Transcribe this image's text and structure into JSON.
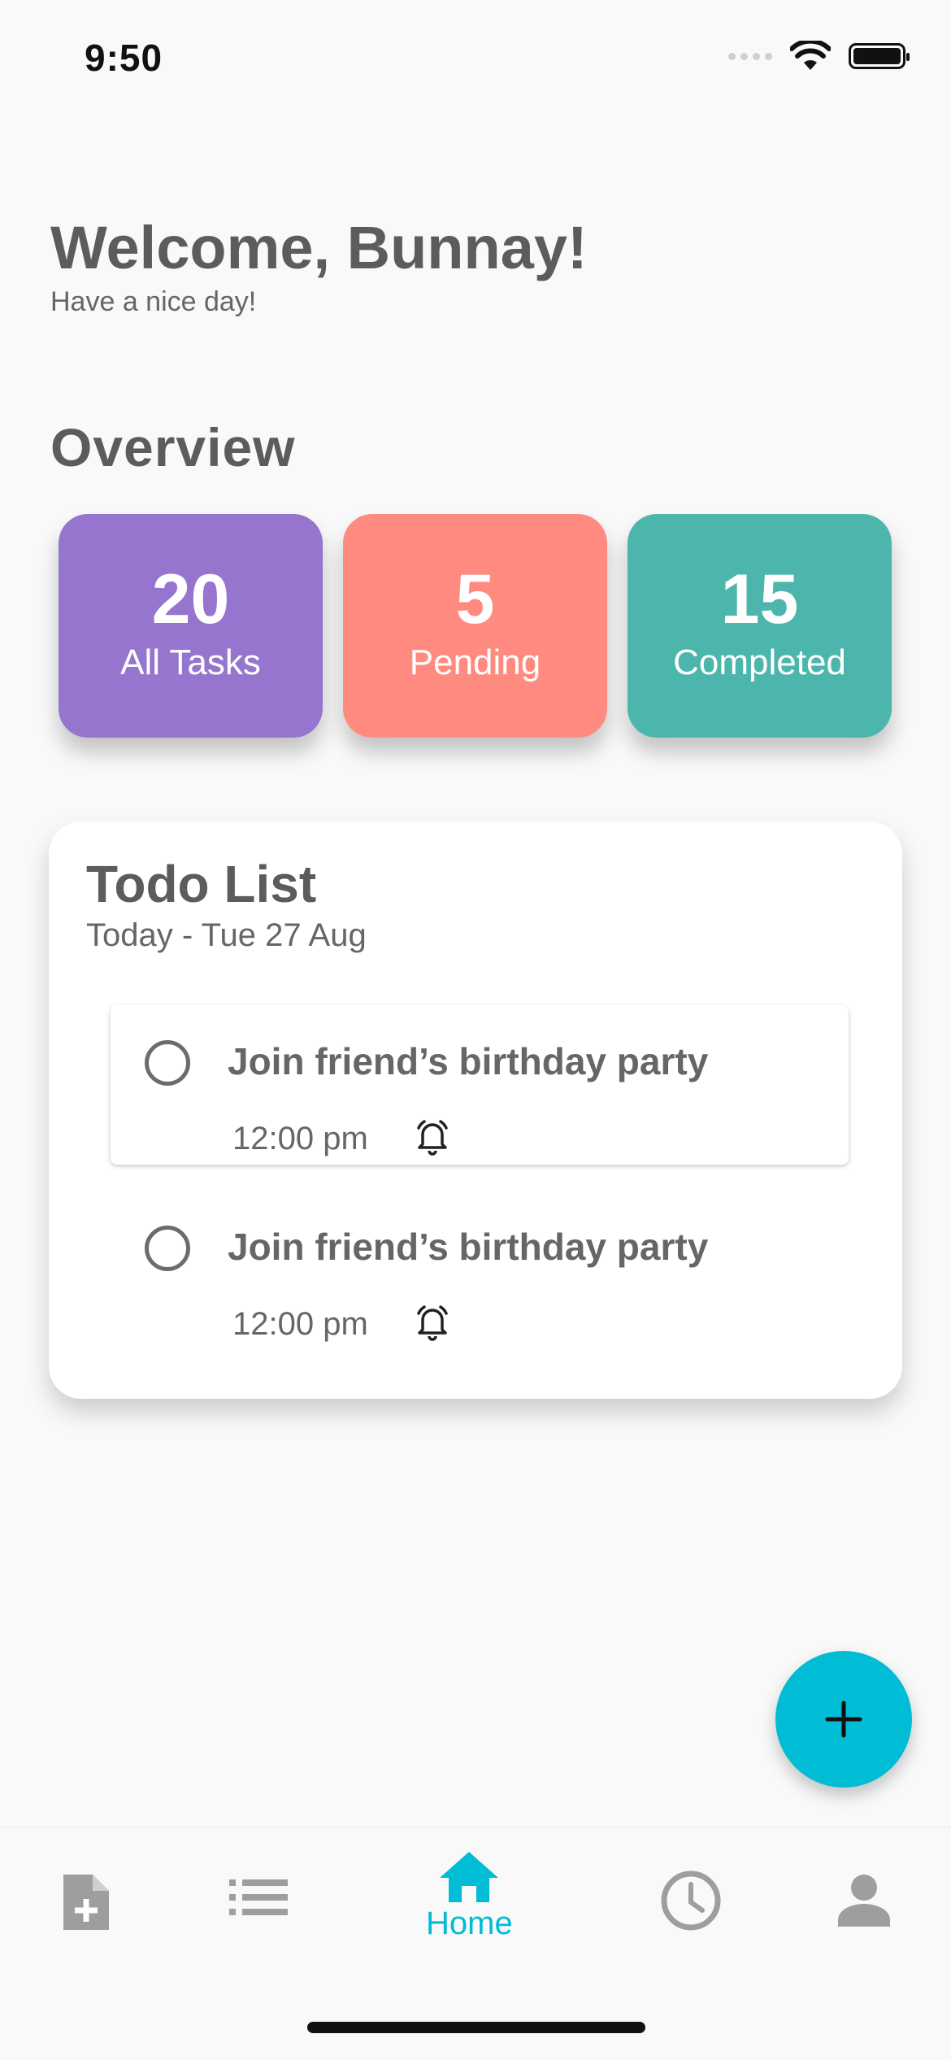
{
  "status_bar": {
    "time": "9:50"
  },
  "header": {
    "title": "Welcome, Bunnay!",
    "subtitle": "Have a nice day!"
  },
  "overview": {
    "title": "Overview",
    "cards": [
      {
        "value": "20",
        "label": "All Tasks",
        "color": "#9575cd"
      },
      {
        "value": "5",
        "label": "Pending",
        "color": "#ff8a80"
      },
      {
        "value": "15",
        "label": "Completed",
        "color": "#4db6ac"
      }
    ]
  },
  "todo": {
    "title": "Todo List",
    "date": "Today - Tue 27 Aug",
    "items": [
      {
        "text": "Join friend’s birthday party",
        "time": "12:00 pm",
        "icon": "alarm-icon"
      },
      {
        "text": "Join friend’s birthday party",
        "time": "12:00 pm",
        "icon": "alarm-icon"
      }
    ]
  },
  "fab": {
    "icon": "plus-icon",
    "color": "#00bcd4"
  },
  "nav": {
    "active_color": "#00bcd4",
    "inactive_color": "#9e9e9e",
    "items": [
      {
        "icon": "add-document-icon"
      },
      {
        "icon": "list-icon"
      },
      {
        "icon": "home-icon",
        "label": "Home"
      },
      {
        "icon": "clock-icon"
      },
      {
        "icon": "person-icon"
      }
    ]
  }
}
